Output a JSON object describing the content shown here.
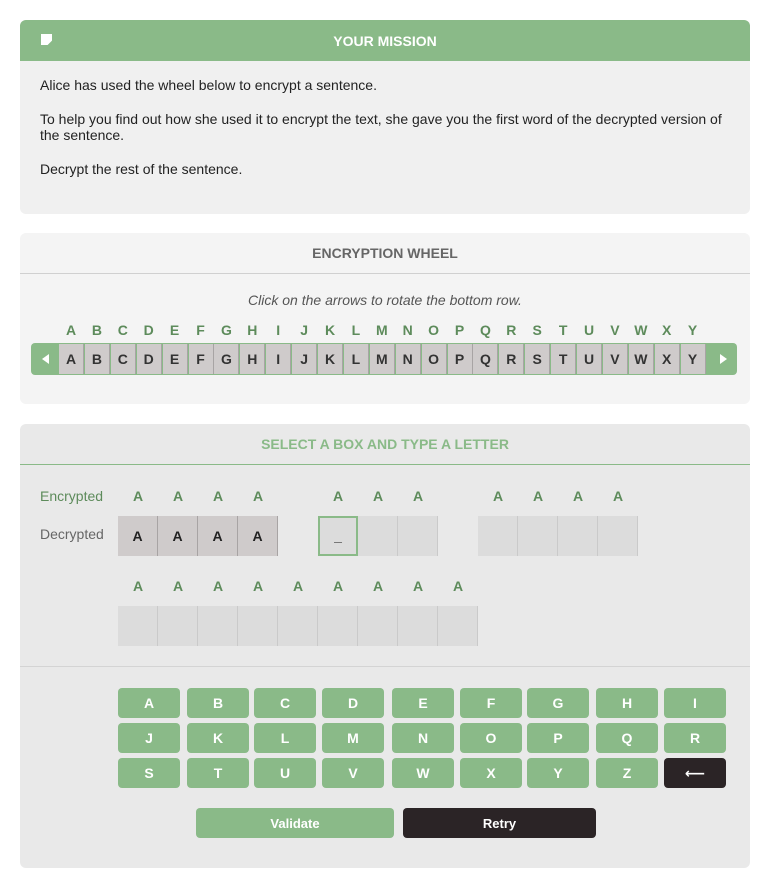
{
  "mission": {
    "title": "YOUR MISSION",
    "p1": "Alice has used the wheel below to encrypt a sentence.",
    "p2": "To help you find out how she used it to encrypt the text, she gave you the first word of the decrypted version of the sentence.",
    "p3": "Decrypt the rest of the sentence."
  },
  "wheel": {
    "title": "ENCRYPTION WHEEL",
    "hint": "Click on the arrows to rotate the bottom row.",
    "top_row": [
      "A",
      "B",
      "C",
      "D",
      "E",
      "F",
      "G",
      "H",
      "I",
      "J",
      "K",
      "L",
      "M",
      "N",
      "O",
      "P",
      "Q",
      "R",
      "S",
      "T",
      "U",
      "V",
      "W",
      "X",
      "Y"
    ],
    "bottom_row": [
      "A",
      "B",
      "C",
      "D",
      "E",
      "F",
      "G",
      "H",
      "I",
      "J",
      "K",
      "L",
      "M",
      "N",
      "O",
      "P",
      "Q",
      "R",
      "S",
      "T",
      "U",
      "V",
      "W",
      "X",
      "Y"
    ]
  },
  "select": {
    "title": "SELECT A BOX AND TYPE A LETTER",
    "encrypted_label": "Encrypted",
    "decrypted_label": "Decrypted",
    "words": [
      {
        "encrypted": [
          "A",
          "A",
          "A",
          "A"
        ],
        "decrypted": [
          "A",
          "A",
          "A",
          "A"
        ]
      },
      {
        "encrypted": [
          "A",
          "A",
          "A"
        ],
        "decrypted": [
          "_",
          "",
          ""
        ]
      },
      {
        "encrypted": [
          "A",
          "A",
          "A",
          "A"
        ],
        "decrypted": [
          "",
          "",
          "",
          ""
        ]
      },
      {
        "encrypted": [
          "A",
          "A",
          "A",
          "A",
          "A",
          "A",
          "A",
          "A",
          "A"
        ],
        "decrypted": [
          "",
          "",
          "",
          "",
          "",
          "",
          "",
          "",
          ""
        ]
      }
    ],
    "keys": [
      "A",
      "B",
      "C",
      "D",
      "E",
      "F",
      "G",
      "H",
      "I",
      "J",
      "K",
      "L",
      "M",
      "N",
      "O",
      "P",
      "Q",
      "R",
      "S",
      "T",
      "U",
      "V",
      "W",
      "X",
      "Y",
      "Z",
      "⟵"
    ],
    "validate_label": "Validate",
    "retry_label": "Retry"
  },
  "colors": {
    "accent_green": "#8aba88",
    "dark_green": "#5d8b5b",
    "dark_button": "#2b2426"
  },
  "icons": [
    "note-icon",
    "arrow-left-icon",
    "arrow-right-icon",
    "backspace-icon"
  ]
}
